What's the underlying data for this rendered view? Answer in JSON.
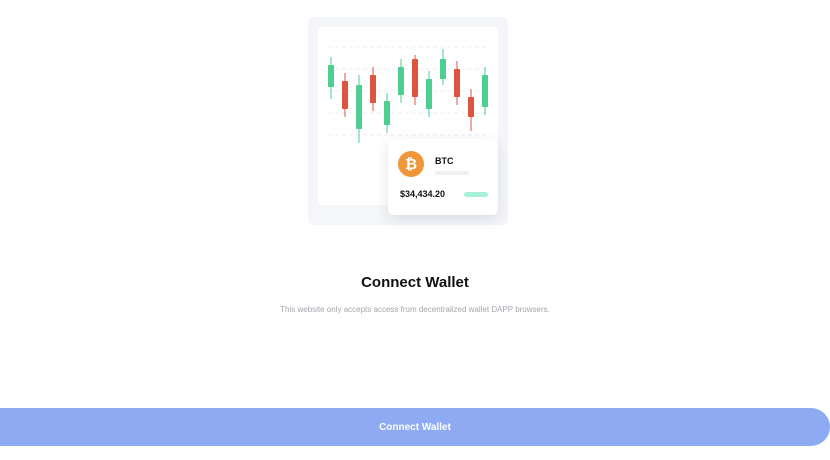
{
  "colors": {
    "up_candle": "#4ecf91",
    "down_candle": "#dd5541",
    "coin_logo": "#f0963a",
    "button_bg": "#8eaaf2",
    "price_pill": "#a6f0d7"
  },
  "illustration": {
    "candles": [
      {
        "trend": "up"
      },
      {
        "trend": "down"
      },
      {
        "trend": "up"
      },
      {
        "trend": "down"
      },
      {
        "trend": "up"
      },
      {
        "trend": "up"
      },
      {
        "trend": "down"
      },
      {
        "trend": "up"
      },
      {
        "trend": "up"
      },
      {
        "trend": "down"
      },
      {
        "trend": "down"
      },
      {
        "trend": "up"
      }
    ],
    "coin_card": {
      "icon": "bitcoin-icon",
      "logo_glyph": "₿",
      "symbol": "BTC",
      "price": "$34,434.20"
    }
  },
  "main": {
    "title": "Connect Wallet",
    "subtitle": "This website only accepts access from decentralized wallet DAPP browsers."
  },
  "footer": {
    "connect_button_label": "Connect Wallet"
  }
}
